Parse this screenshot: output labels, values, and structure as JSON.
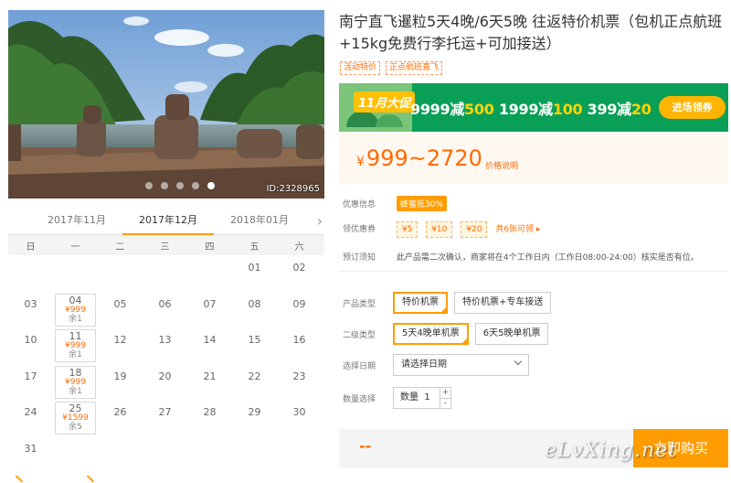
{
  "photo": {
    "id_label": "ID:2328965",
    "slide_count": 5,
    "active_slide": 4
  },
  "calendar": {
    "months": [
      "2017年11月",
      "2017年12月",
      "2018年01月"
    ],
    "active_month": "2017年12月",
    "weekdays": [
      "日",
      "一",
      "二",
      "三",
      "四",
      "五",
      "六"
    ],
    "weeks": [
      [
        null,
        null,
        null,
        null,
        null,
        {
          "d": "01"
        },
        {
          "d": "02"
        }
      ],
      [
        {
          "d": "03"
        },
        {
          "d": "04",
          "price": "¥999",
          "remain": "余1"
        },
        {
          "d": "05"
        },
        {
          "d": "06"
        },
        {
          "d": "07"
        },
        {
          "d": "08"
        },
        {
          "d": "09"
        }
      ],
      [
        {
          "d": "10"
        },
        {
          "d": "11",
          "price": "¥999",
          "remain": "余1"
        },
        {
          "d": "12"
        },
        {
          "d": "13"
        },
        {
          "d": "14"
        },
        {
          "d": "15"
        },
        {
          "d": "16"
        }
      ],
      [
        {
          "d": "17"
        },
        {
          "d": "18",
          "price": "¥999",
          "remain": "余1"
        },
        {
          "d": "19"
        },
        {
          "d": "20"
        },
        {
          "d": "21"
        },
        {
          "d": "22"
        },
        {
          "d": "23"
        }
      ],
      [
        {
          "d": "24"
        },
        {
          "d": "25",
          "price": "¥1599",
          "remain": "余5"
        },
        {
          "d": "26"
        },
        {
          "d": "27"
        },
        {
          "d": "28"
        },
        {
          "d": "29"
        },
        {
          "d": "30"
        }
      ],
      [
        {
          "d": "31"
        },
        null,
        null,
        null,
        null,
        null,
        null
      ]
    ]
  },
  "product": {
    "title": "南宁直飞暹粒5天4晚/6天5晚 往返特价机票（包机正点航班+15kg免费行李托运+可加接送）",
    "tags": [
      "活动特价",
      "正点航班直飞"
    ]
  },
  "banner": {
    "badge": "11月大促",
    "offers": [
      {
        "amount": "9999减",
        "cut": "500"
      },
      {
        "amount": "1999减",
        "cut": "100"
      },
      {
        "amount": "399减",
        "cut": "20"
      }
    ],
    "button": "进场领券"
  },
  "price": {
    "currency": "¥",
    "range": "999~2720",
    "note": "价格说明"
  },
  "discount": {
    "label": "优惠信息",
    "value": "蜂蜜抵30%"
  },
  "coupons": {
    "label": "领优惠券",
    "items": [
      "¥5",
      "¥10",
      "¥20"
    ],
    "more": "共6张可领 ▸"
  },
  "notice": {
    "label": "预订须知",
    "text": "此产品需二次确认，商家将在4个工作日内（工作日08:00-24:00）核实是否有位。"
  },
  "product_type": {
    "label": "产品类型",
    "options": [
      "特价机票",
      "特价机票+专车接送"
    ],
    "selected": 0
  },
  "sub_type": {
    "label": "二级类型",
    "options": [
      "5天4晚单机票",
      "6天5晚单机票"
    ],
    "selected": 0
  },
  "date_select": {
    "label": "选择日期",
    "placeholder": "请选择日期"
  },
  "quantity": {
    "label": "数量选择",
    "prefix": "数量",
    "value": "1",
    "plus": "+",
    "minus": "-"
  },
  "buy": {
    "total": "--",
    "button": "立即购买"
  },
  "colors": {
    "accent": "#ff9d00",
    "price": "#ff6a00",
    "banner": "#0a9f57"
  },
  "watermark": "eLvXing.net"
}
